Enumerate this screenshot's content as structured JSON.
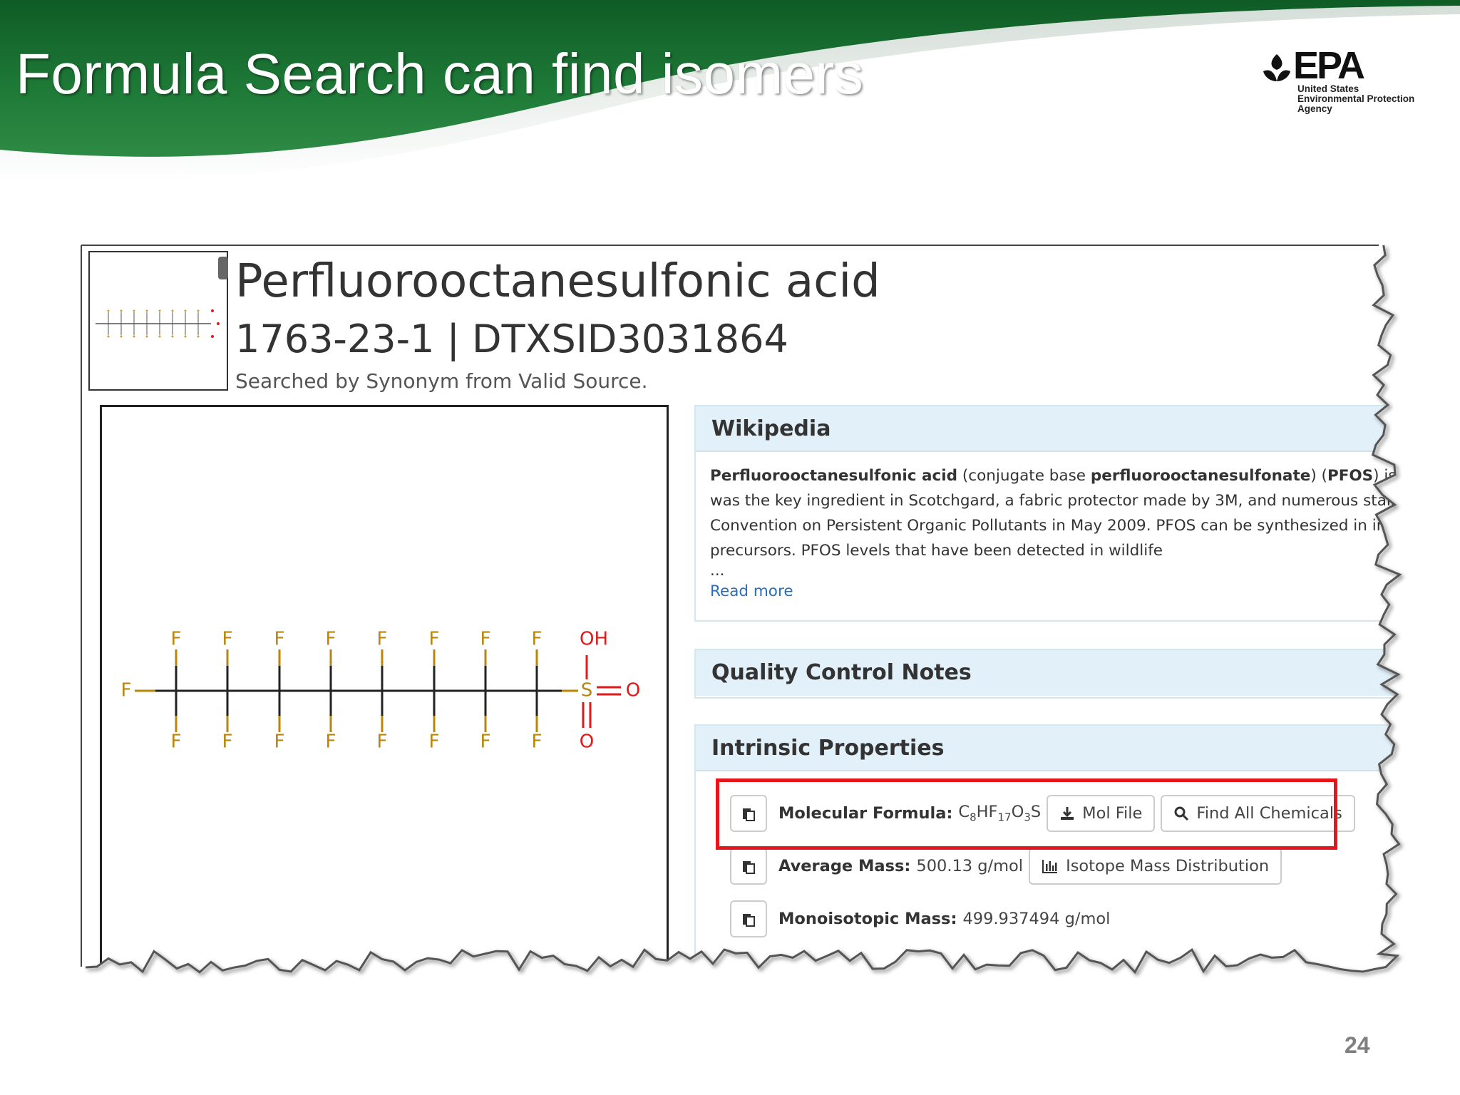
{
  "slide": {
    "title": "Formula Search can find isomers",
    "page_number": "24",
    "logo": {
      "word": "EPA",
      "sub_line1": "United States",
      "sub_line2": "Environmental Protection",
      "sub_line3": "Agency"
    }
  },
  "chemical": {
    "name": "Perfluorooctanesulfonic acid",
    "ids": "1763-23-1 | DTXSID3031864",
    "search_note": "Searched by Synonym from Valid Source.",
    "structure_atoms": {
      "fluorine": "F",
      "sulfur": "S",
      "oxygen": "O",
      "hydroxyl": "OH"
    }
  },
  "wikipedia": {
    "heading": "Wikipedia",
    "line1_bold1": "Perfluorooctanesulfonic acid",
    "line1_text1": " (conjugate base ",
    "line1_bold2": "perfluorooctanesulfonate",
    "line1_text2": ") (",
    "line1_bold3": "PFOS",
    "line1_text3": ") is an ar",
    "line2": "was the key ingredient in Scotchgard, a fabric protector made by 3M, and numerous stain r",
    "line3": "Convention on Persistent Organic Pollutants in May 2009. PFOS can be synthesized in indus",
    "line4": "precursors. PFOS levels that have been detected in wildlife",
    "ellipsis": "...",
    "read_more": "Read more"
  },
  "qc": {
    "heading": "Quality Control Notes"
  },
  "intrinsic": {
    "heading": "Intrinsic Properties",
    "molecular_formula_label": "Molecular Formula:",
    "formula": {
      "c": "C",
      "c_n": "8",
      "h": "HF",
      "f_n": "17",
      "o": "O",
      "o_n": "3",
      "s": "S"
    },
    "mol_file_button": "Mol File",
    "find_all_button": "Find All Chemicals",
    "average_mass_label": "Average Mass:",
    "average_mass_value": "500.13 g/mol",
    "isotope_button": "Isotope Mass Distribution",
    "monoisotopic_mass_label": "Monoisotopic Mass:",
    "monoisotopic_mass_value": "499.937494 g/mol"
  },
  "colors": {
    "header_green": "#1e7a3a",
    "highlight_red": "#e4171e",
    "fluorine_gold": "#b8860b",
    "oxygen_red": "#e0191b",
    "panel_head_blue": "#e2f0fa",
    "link_blue": "#2a6ebb"
  }
}
